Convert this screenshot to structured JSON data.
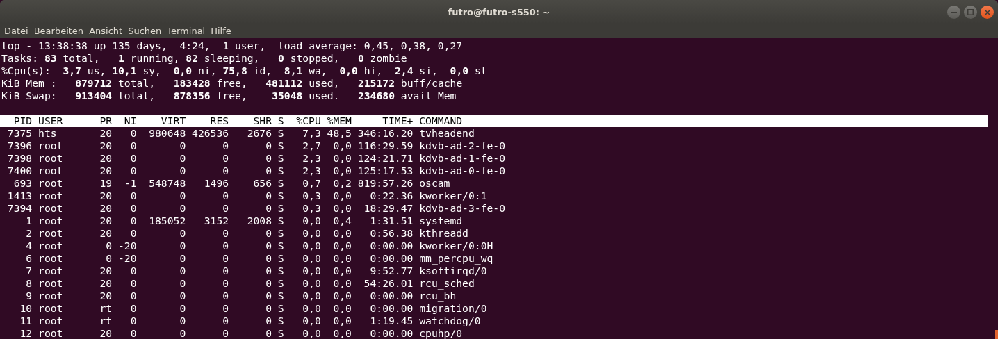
{
  "window": {
    "title": "futro@futro-s550: ~"
  },
  "menu": [
    "Datei",
    "Bearbeiten",
    "Ansicht",
    "Suchen",
    "Terminal",
    "Hilfe"
  ],
  "summary": [
    "top - 13:38:38 up 135 days,  4:24,  1 user,  load average: 0,45, 0,38, 0,27",
    "Tasks: **83** total,   **1** running, **82** sleeping,   **0** stopped,   **0** zombie",
    "%Cpu(s):  **3,7** us, **10,1** sy,  **0,0** ni, **75,8** id,  **8,1** wa,  **0,0** hi,  **2,4** si,  **0,0** st",
    "KiB Mem :   **879712** total,   **183428** free,   **481112** used,   **215172** buff/cache",
    "KiB Swap:   **913404** total,   **878356** free,    **35048** used.   **234680** avail Mem"
  ],
  "table": {
    "columns": [
      "PID",
      "USER",
      "PR",
      "NI",
      "VIRT",
      "RES",
      "SHR",
      "S",
      "%CPU",
      "%MEM",
      "TIME+",
      "COMMAND"
    ],
    "rows": [
      [
        "7375",
        "hts",
        "20",
        "0",
        "980648",
        "426536",
        "2676",
        "S",
        "7,3",
        "48,5",
        "346:16.20",
        "tvheadend"
      ],
      [
        "7396",
        "root",
        "20",
        "0",
        "0",
        "0",
        "0",
        "S",
        "2,7",
        "0,0",
        "116:29.59",
        "kdvb-ad-2-fe-0"
      ],
      [
        "7398",
        "root",
        "20",
        "0",
        "0",
        "0",
        "0",
        "S",
        "2,3",
        "0,0",
        "124:21.71",
        "kdvb-ad-1-fe-0"
      ],
      [
        "7400",
        "root",
        "20",
        "0",
        "0",
        "0",
        "0",
        "S",
        "2,3",
        "0,0",
        "125:17.53",
        "kdvb-ad-0-fe-0"
      ],
      [
        "693",
        "root",
        "19",
        "-1",
        "548748",
        "1496",
        "656",
        "S",
        "0,7",
        "0,2",
        "819:57.26",
        "oscam"
      ],
      [
        "1413",
        "root",
        "20",
        "0",
        "0",
        "0",
        "0",
        "S",
        "0,3",
        "0,0",
        "0:22.36",
        "kworker/0:1"
      ],
      [
        "7394",
        "root",
        "20",
        "0",
        "0",
        "0",
        "0",
        "S",
        "0,3",
        "0,0",
        "18:29.47",
        "kdvb-ad-3-fe-0"
      ],
      [
        "1",
        "root",
        "20",
        "0",
        "185052",
        "3152",
        "2008",
        "S",
        "0,0",
        "0,4",
        "1:31.51",
        "systemd"
      ],
      [
        "2",
        "root",
        "20",
        "0",
        "0",
        "0",
        "0",
        "S",
        "0,0",
        "0,0",
        "0:56.38",
        "kthreadd"
      ],
      [
        "4",
        "root",
        "0",
        "-20",
        "0",
        "0",
        "0",
        "S",
        "0,0",
        "0,0",
        "0:00.00",
        "kworker/0:0H"
      ],
      [
        "6",
        "root",
        "0",
        "-20",
        "0",
        "0",
        "0",
        "S",
        "0,0",
        "0,0",
        "0:00.00",
        "mm_percpu_wq"
      ],
      [
        "7",
        "root",
        "20",
        "0",
        "0",
        "0",
        "0",
        "S",
        "0,0",
        "0,0",
        "9:52.77",
        "ksoftirqd/0"
      ],
      [
        "8",
        "root",
        "20",
        "0",
        "0",
        "0",
        "0",
        "S",
        "0,0",
        "0,0",
        "54:26.01",
        "rcu_sched"
      ],
      [
        "9",
        "root",
        "20",
        "0",
        "0",
        "0",
        "0",
        "S",
        "0,0",
        "0,0",
        "0:00.00",
        "rcu_bh"
      ],
      [
        "10",
        "root",
        "rt",
        "0",
        "0",
        "0",
        "0",
        "S",
        "0,0",
        "0,0",
        "0:00.00",
        "migration/0"
      ],
      [
        "11",
        "root",
        "rt",
        "0",
        "0",
        "0",
        "0",
        "S",
        "0,0",
        "0,0",
        "1:19.45",
        "watchdog/0"
      ],
      [
        "12",
        "root",
        "20",
        "0",
        "0",
        "0",
        "0",
        "S",
        "0,0",
        "0,0",
        "0:00.00",
        "cpuhp/0"
      ]
    ]
  }
}
